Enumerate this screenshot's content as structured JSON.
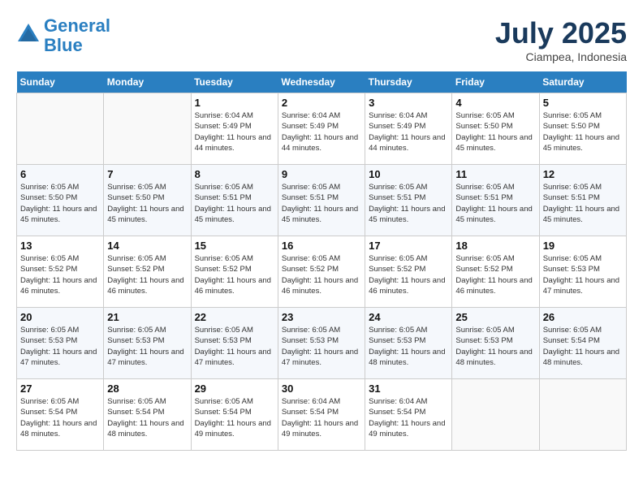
{
  "header": {
    "logo_line1": "General",
    "logo_line2": "Blue",
    "month_title": "July 2025",
    "location": "Ciampea, Indonesia"
  },
  "weekdays": [
    "Sunday",
    "Monday",
    "Tuesday",
    "Wednesday",
    "Thursday",
    "Friday",
    "Saturday"
  ],
  "weeks": [
    [
      {
        "day": "",
        "info": ""
      },
      {
        "day": "",
        "info": ""
      },
      {
        "day": "1",
        "info": "Sunrise: 6:04 AM\nSunset: 5:49 PM\nDaylight: 11 hours and 44 minutes."
      },
      {
        "day": "2",
        "info": "Sunrise: 6:04 AM\nSunset: 5:49 PM\nDaylight: 11 hours and 44 minutes."
      },
      {
        "day": "3",
        "info": "Sunrise: 6:04 AM\nSunset: 5:49 PM\nDaylight: 11 hours and 44 minutes."
      },
      {
        "day": "4",
        "info": "Sunrise: 6:05 AM\nSunset: 5:50 PM\nDaylight: 11 hours and 45 minutes."
      },
      {
        "day": "5",
        "info": "Sunrise: 6:05 AM\nSunset: 5:50 PM\nDaylight: 11 hours and 45 minutes."
      }
    ],
    [
      {
        "day": "6",
        "info": "Sunrise: 6:05 AM\nSunset: 5:50 PM\nDaylight: 11 hours and 45 minutes."
      },
      {
        "day": "7",
        "info": "Sunrise: 6:05 AM\nSunset: 5:50 PM\nDaylight: 11 hours and 45 minutes."
      },
      {
        "day": "8",
        "info": "Sunrise: 6:05 AM\nSunset: 5:51 PM\nDaylight: 11 hours and 45 minutes."
      },
      {
        "day": "9",
        "info": "Sunrise: 6:05 AM\nSunset: 5:51 PM\nDaylight: 11 hours and 45 minutes."
      },
      {
        "day": "10",
        "info": "Sunrise: 6:05 AM\nSunset: 5:51 PM\nDaylight: 11 hours and 45 minutes."
      },
      {
        "day": "11",
        "info": "Sunrise: 6:05 AM\nSunset: 5:51 PM\nDaylight: 11 hours and 45 minutes."
      },
      {
        "day": "12",
        "info": "Sunrise: 6:05 AM\nSunset: 5:51 PM\nDaylight: 11 hours and 45 minutes."
      }
    ],
    [
      {
        "day": "13",
        "info": "Sunrise: 6:05 AM\nSunset: 5:52 PM\nDaylight: 11 hours and 46 minutes."
      },
      {
        "day": "14",
        "info": "Sunrise: 6:05 AM\nSunset: 5:52 PM\nDaylight: 11 hours and 46 minutes."
      },
      {
        "day": "15",
        "info": "Sunrise: 6:05 AM\nSunset: 5:52 PM\nDaylight: 11 hours and 46 minutes."
      },
      {
        "day": "16",
        "info": "Sunrise: 6:05 AM\nSunset: 5:52 PM\nDaylight: 11 hours and 46 minutes."
      },
      {
        "day": "17",
        "info": "Sunrise: 6:05 AM\nSunset: 5:52 PM\nDaylight: 11 hours and 46 minutes."
      },
      {
        "day": "18",
        "info": "Sunrise: 6:05 AM\nSunset: 5:52 PM\nDaylight: 11 hours and 46 minutes."
      },
      {
        "day": "19",
        "info": "Sunrise: 6:05 AM\nSunset: 5:53 PM\nDaylight: 11 hours and 47 minutes."
      }
    ],
    [
      {
        "day": "20",
        "info": "Sunrise: 6:05 AM\nSunset: 5:53 PM\nDaylight: 11 hours and 47 minutes."
      },
      {
        "day": "21",
        "info": "Sunrise: 6:05 AM\nSunset: 5:53 PM\nDaylight: 11 hours and 47 minutes."
      },
      {
        "day": "22",
        "info": "Sunrise: 6:05 AM\nSunset: 5:53 PM\nDaylight: 11 hours and 47 minutes."
      },
      {
        "day": "23",
        "info": "Sunrise: 6:05 AM\nSunset: 5:53 PM\nDaylight: 11 hours and 47 minutes."
      },
      {
        "day": "24",
        "info": "Sunrise: 6:05 AM\nSunset: 5:53 PM\nDaylight: 11 hours and 48 minutes."
      },
      {
        "day": "25",
        "info": "Sunrise: 6:05 AM\nSunset: 5:53 PM\nDaylight: 11 hours and 48 minutes."
      },
      {
        "day": "26",
        "info": "Sunrise: 6:05 AM\nSunset: 5:54 PM\nDaylight: 11 hours and 48 minutes."
      }
    ],
    [
      {
        "day": "27",
        "info": "Sunrise: 6:05 AM\nSunset: 5:54 PM\nDaylight: 11 hours and 48 minutes."
      },
      {
        "day": "28",
        "info": "Sunrise: 6:05 AM\nSunset: 5:54 PM\nDaylight: 11 hours and 48 minutes."
      },
      {
        "day": "29",
        "info": "Sunrise: 6:05 AM\nSunset: 5:54 PM\nDaylight: 11 hours and 49 minutes."
      },
      {
        "day": "30",
        "info": "Sunrise: 6:04 AM\nSunset: 5:54 PM\nDaylight: 11 hours and 49 minutes."
      },
      {
        "day": "31",
        "info": "Sunrise: 6:04 AM\nSunset: 5:54 PM\nDaylight: 11 hours and 49 minutes."
      },
      {
        "day": "",
        "info": ""
      },
      {
        "day": "",
        "info": ""
      }
    ]
  ]
}
